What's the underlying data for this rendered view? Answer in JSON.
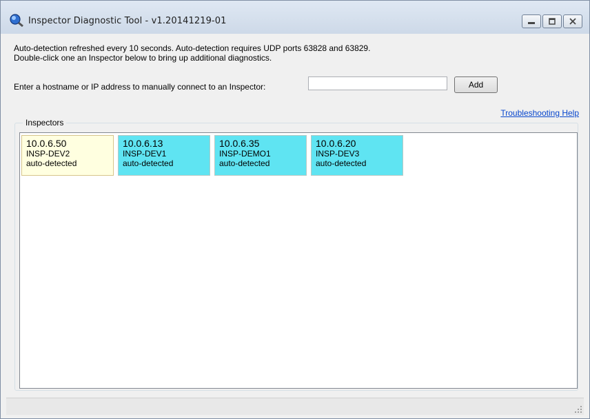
{
  "window": {
    "title": "Inspector Diagnostic Tool - v1.20141219-01"
  },
  "info": {
    "line1": "Auto-detection refreshed every 10 seconds. Auto-detection requires UDP ports 63828 and 63829.",
    "line2": "Double-click one an Inspector below to bring up additional diagnostics."
  },
  "connect": {
    "label": "Enter a hostname or IP address to manually connect to an Inspector:",
    "value": "",
    "add_label": "Add"
  },
  "help_link": "Troubleshooting Help",
  "inspectors": {
    "title": "Inspectors",
    "items": [
      {
        "ip": "10.0.6.50",
        "name": "INSP-DEV2",
        "status": "auto-detected"
      },
      {
        "ip": "10.0.6.13",
        "name": "INSP-DEV1",
        "status": "auto-detected"
      },
      {
        "ip": "10.0.6.35",
        "name": "INSP-DEMO1",
        "status": "auto-detected"
      },
      {
        "ip": "10.0.6.20",
        "name": "INSP-DEV3",
        "status": "auto-detected"
      }
    ]
  },
  "colors": {
    "selected_tile": "#ffffe0",
    "tile": "#5fe4f2",
    "link": "#0645cd"
  }
}
